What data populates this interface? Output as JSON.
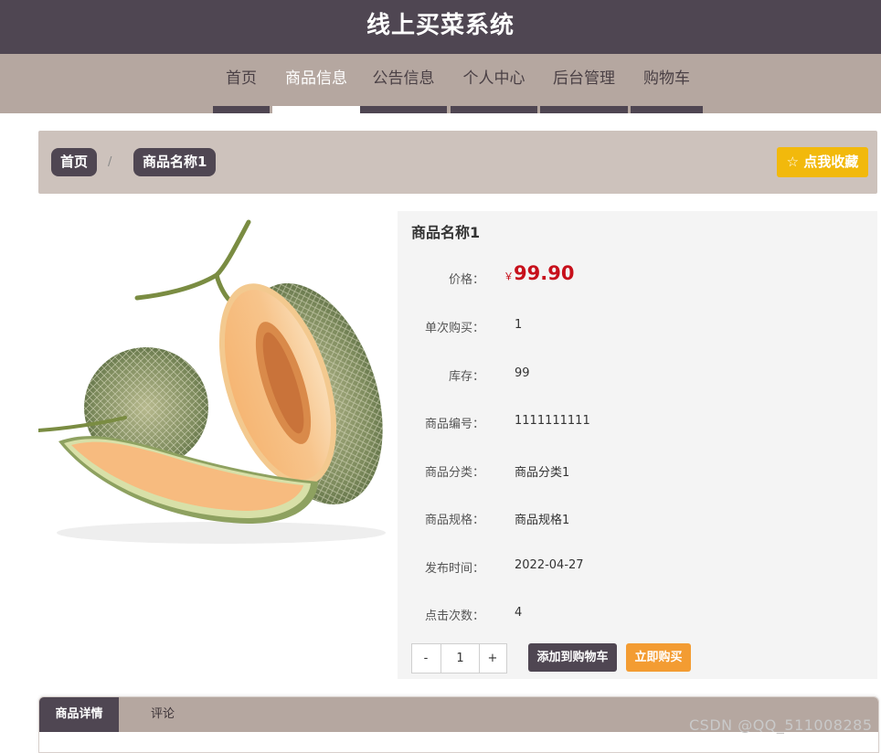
{
  "header": {
    "title": "线上买菜系统"
  },
  "nav": {
    "items": [
      {
        "label": "首页"
      },
      {
        "label": "商品信息"
      },
      {
        "label": "公告信息"
      },
      {
        "label": "个人中心"
      },
      {
        "label": "后台管理"
      },
      {
        "label": "购物车"
      }
    ],
    "active_index": 1
  },
  "breadcrumb": {
    "home": "首页",
    "separator": "/",
    "current": "商品名称1"
  },
  "favorite": {
    "icon": "star-outline-icon",
    "label": "点我收藏"
  },
  "product": {
    "name": "商品名称1",
    "image": "cantaloupe-melon-photo",
    "currency": "￥",
    "price": "99.90",
    "rows": [
      {
        "label": "单次购买：",
        "value": "1"
      },
      {
        "label": "库存：",
        "value": "99"
      },
      {
        "label": "商品编号：",
        "value": "1111111111"
      },
      {
        "label": "商品分类：",
        "value": "商品分类1"
      },
      {
        "label": "商品规格：",
        "value": "商品规格1"
      },
      {
        "label": "发布时间：",
        "value": "2022-04-27"
      },
      {
        "label": "点击次数：",
        "value": "4"
      }
    ],
    "price_label": "价格："
  },
  "quantity": {
    "minus": "-",
    "value": "1",
    "plus": "+"
  },
  "actions": {
    "add_to_cart": "添加到购物车",
    "buy_now": "立即购买"
  },
  "tabs": {
    "items": [
      {
        "label": "商品详情"
      },
      {
        "label": "评论"
      }
    ],
    "active_index": 0
  },
  "watermark": "CSDN @QQ_511008285",
  "colors": {
    "header": "#4f4652",
    "nav": "#b5a7a0",
    "price": "#c7101b",
    "favorite": "#f2b90c",
    "buy": "#f39c32"
  }
}
